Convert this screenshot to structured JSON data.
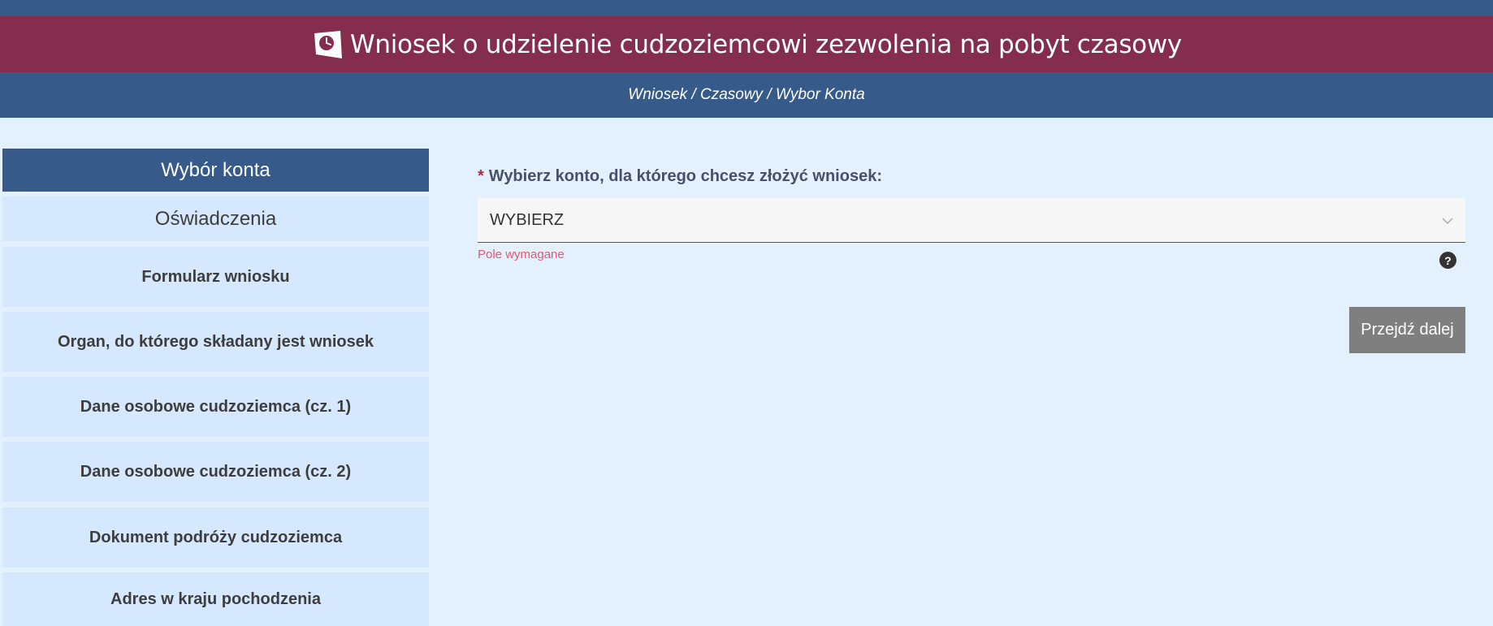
{
  "header": {
    "title": "Wniosek o udzielenie cudzoziemcowi zezwolenia na pobyt czasowy",
    "icon": "clock-document-icon"
  },
  "breadcrumb": {
    "text": "Wniosek / Czasowy / Wybor Konta"
  },
  "sidebar": {
    "items": [
      {
        "label": "Wybór konta",
        "active": true
      },
      {
        "label": "Oświadczenia"
      },
      {
        "label": "Formularz wniosku"
      },
      {
        "label": "Organ, do którego składany jest wniosek"
      },
      {
        "label": "Dane osobowe cudzoziemca (cz. 1)"
      },
      {
        "label": "Dane osobowe cudzoziemca (cz. 2)"
      },
      {
        "label": "Dokument podróży cudzoziemca"
      },
      {
        "label": "Adres w kraju pochodzenia"
      }
    ]
  },
  "form": {
    "required_marker": "*",
    "account_label": "Wybierz konto, dla którego chcesz złożyć wniosek:",
    "account_value": "WYBIERZ",
    "error": "Pole wymagane",
    "help": "?",
    "next_label": "Przejdź dalej"
  },
  "colors": {
    "title_bar": "#842d4d",
    "nav_bar": "#365b8b",
    "background": "#e3f0fe",
    "sidebar_item": "#d6e8fd",
    "button": "#7f7f7f",
    "error": "#e05b6d"
  }
}
